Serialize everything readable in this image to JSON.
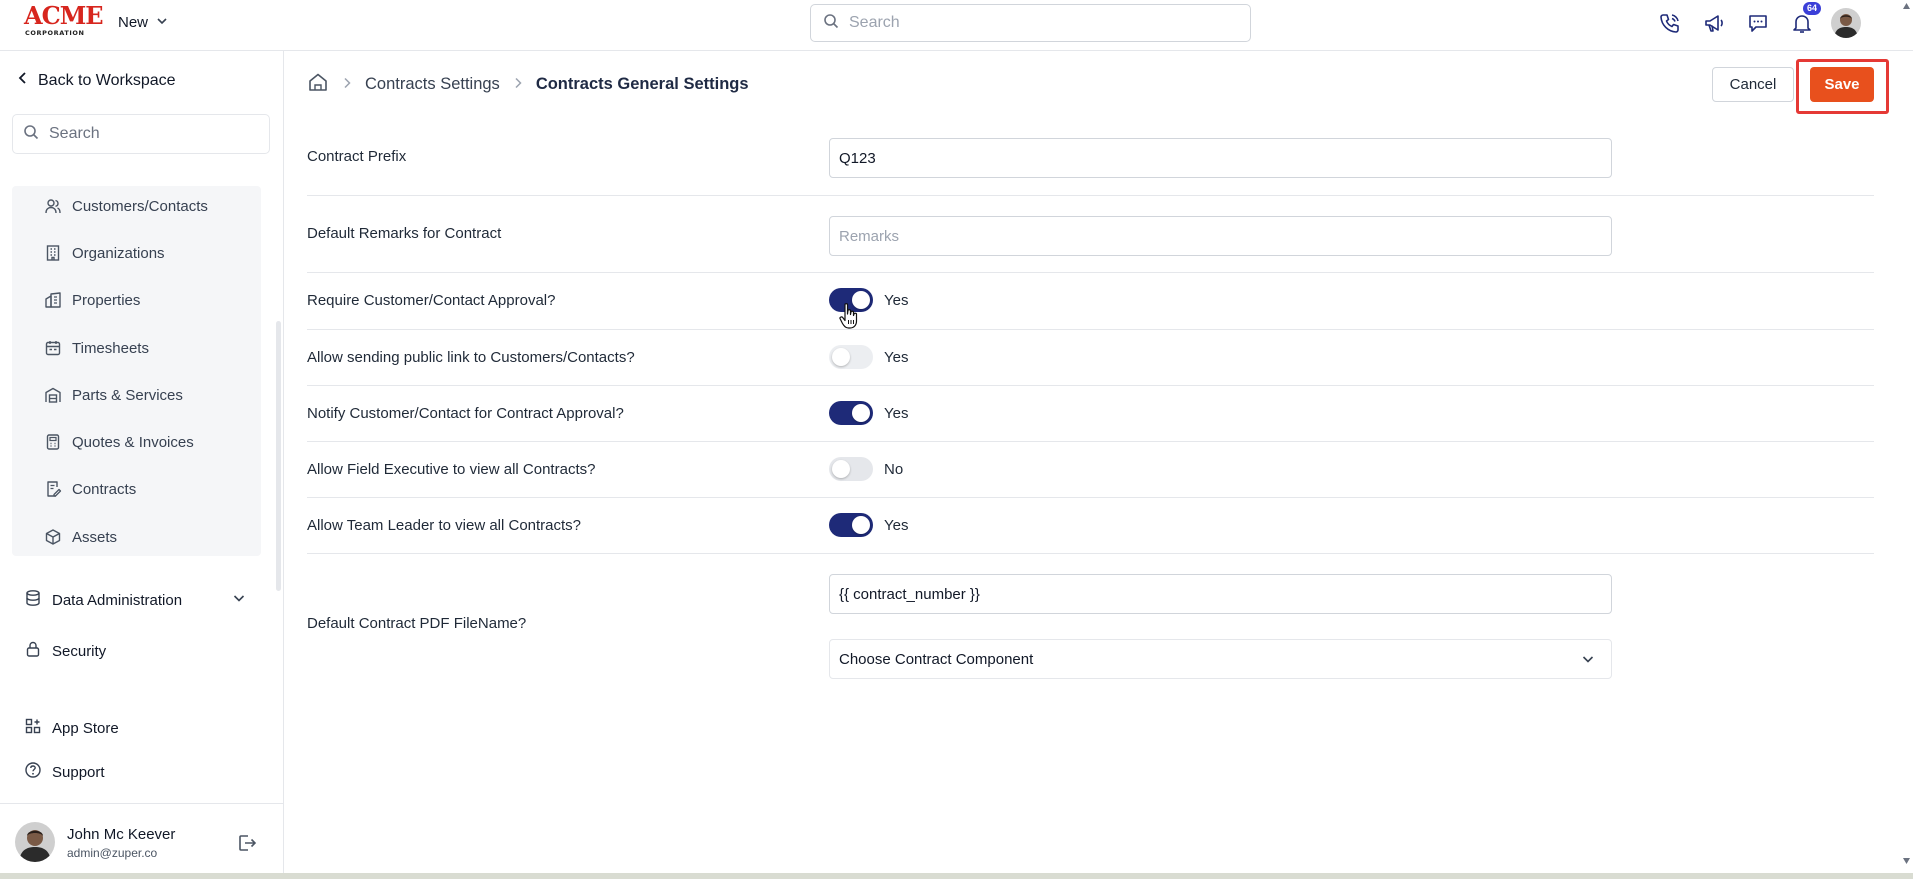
{
  "header": {
    "logo_text": "ACME",
    "logo_subtext": "CORPORATION",
    "new_label": "New",
    "search_placeholder": "Search",
    "notification_count": "64"
  },
  "sidebar": {
    "back_label": "Back to Workspace",
    "search_placeholder": "Search",
    "items": [
      {
        "label": "Customers/Contacts",
        "icon": "contacts-icon"
      },
      {
        "label": "Organizations",
        "icon": "building-icon"
      },
      {
        "label": "Properties",
        "icon": "property-icon"
      },
      {
        "label": "Timesheets",
        "icon": "calendar-icon"
      },
      {
        "label": "Parts & Services",
        "icon": "warehouse-icon"
      },
      {
        "label": "Quotes & Invoices",
        "icon": "calculator-icon"
      },
      {
        "label": "Contracts",
        "icon": "contract-icon"
      },
      {
        "label": "Assets",
        "icon": "cube-icon"
      }
    ],
    "data_admin_label": "Data Administration",
    "security_label": "Security",
    "app_store_label": "App Store",
    "support_label": "Support",
    "user": {
      "name": "John Mc Keever",
      "email": "admin@zuper.co"
    }
  },
  "breadcrumb": {
    "level1": "Contracts Settings",
    "current": "Contracts General Settings"
  },
  "actions": {
    "cancel_label": "Cancel",
    "save_label": "Save"
  },
  "form": {
    "contract_prefix": {
      "label": "Contract Prefix",
      "value": "Q123"
    },
    "default_remarks": {
      "label": "Default Remarks for Contract",
      "value": "",
      "placeholder": "Remarks"
    },
    "require_approval": {
      "label": "Require Customer/Contact Approval?",
      "state": "on",
      "text": "Yes"
    },
    "public_link": {
      "label": "Allow sending public link to Customers/Contacts?",
      "state": "disabled",
      "text": "Yes"
    },
    "notify_approval": {
      "label": "Notify Customer/Contact for Contract Approval?",
      "state": "on",
      "text": "Yes"
    },
    "field_exec_view": {
      "label": "Allow Field Executive to view all Contracts?",
      "state": "off",
      "text": "No"
    },
    "team_leader_view": {
      "label": "Allow Team Leader to view all Contracts?",
      "state": "on",
      "text": "Yes"
    },
    "pdf_filename": {
      "label": "Default Contract PDF FileName?",
      "value": "{{ contract_number }}",
      "component_placeholder": "Choose Contract Component"
    }
  },
  "colors": {
    "accent": "#e8501d",
    "toggle_on": "#1e2a78",
    "highlight": "#e53935"
  }
}
